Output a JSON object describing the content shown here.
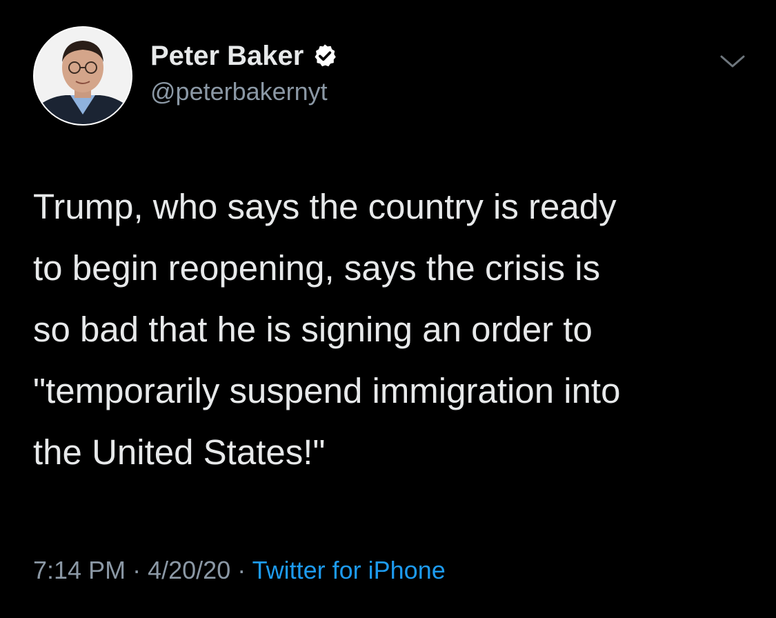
{
  "author": {
    "display_name": "Peter Baker",
    "handle": "@peterbakernyt",
    "verified": true,
    "avatar": "profile-photo"
  },
  "tweet": {
    "text": "Trump, who says the country is ready\nto begin reopening, says the crisis is\nso bad that he is signing an order to\n\"temporarily suspend immigration into\nthe United States!\""
  },
  "meta": {
    "time": "7:14 PM",
    "separator": "·",
    "date": "4/20/20",
    "source": "Twitter for iPhone"
  },
  "icons": {
    "verified": "verified-badge-icon",
    "menu": "chevron-down-icon"
  },
  "colors": {
    "background": "#000000",
    "primary_text": "#e7e9ea",
    "secondary_text": "#8b98a5",
    "link": "#1d9bf0"
  }
}
